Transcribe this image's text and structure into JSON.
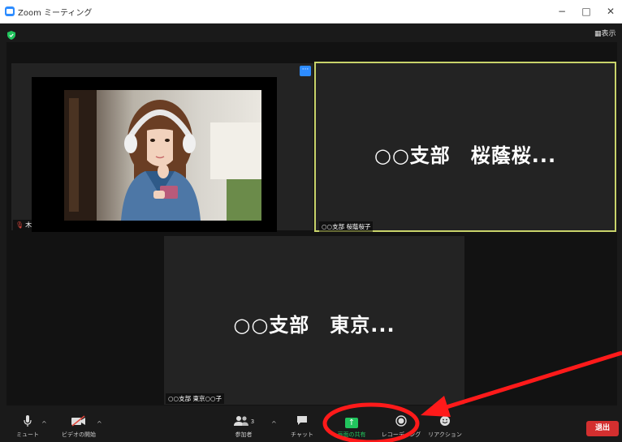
{
  "window": {
    "title": "Zoom ミーティング",
    "minimize": "−",
    "maximize": "□",
    "close": "✕"
  },
  "top": {
    "view_label": "表示",
    "view_icon": "grid-icon"
  },
  "participants": {
    "left": {
      "name_tag": "木"
    },
    "right": {
      "display_name": "○○支部　桜蔭桜...",
      "name_tag": "○○支部  桜蔭桜子"
    },
    "bottom": {
      "display_name": "○○支部　東京...",
      "name_tag": "○○支部  東京○○子"
    }
  },
  "toolbar": {
    "mute_label": "ミュート",
    "start_video_label": "ビデオの開始",
    "participants_label": "参加者",
    "participants_count": "3",
    "chat_label": "チャット",
    "share_screen_label": "画面の共有",
    "record_label": "レコーディング",
    "reactions_label": "リアクション",
    "leave_label": "退出"
  },
  "colors": {
    "active_speaker_border": "#c8d36a",
    "share_green": "#22c55e",
    "leave_red": "#d32f2f",
    "annotation_red": "#ff1a1a",
    "zoom_blue": "#2d8cff"
  }
}
